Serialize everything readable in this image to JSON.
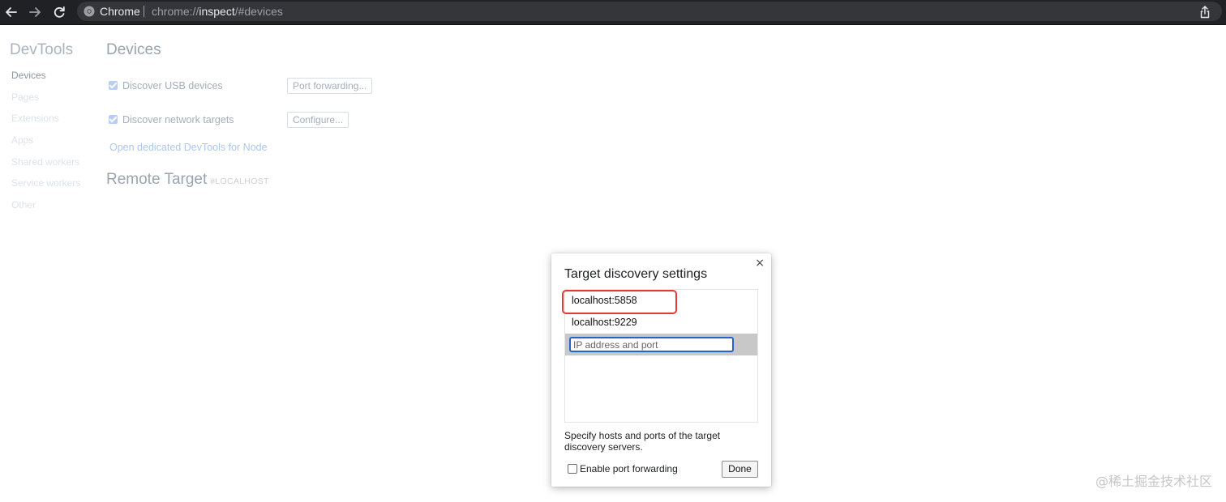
{
  "browser": {
    "tab_title": "Chrome",
    "url_scheme": "chrome://",
    "url_host": "inspect",
    "url_path": "/#devices",
    "icons": {
      "back": "back-arrow-icon",
      "forward": "forward-arrow-icon",
      "reload": "reload-icon",
      "share": "share-icon"
    }
  },
  "devtools": {
    "brand": "DevTools",
    "sidebar": [
      "Devices",
      "Pages",
      "Extensions",
      "Apps",
      "Shared workers",
      "Service workers",
      "Other"
    ],
    "section_title": "Devices",
    "discover_usb": {
      "label": "Discover USB devices",
      "checked": true
    },
    "port_forwarding_button": "Port forwarding...",
    "discover_network": {
      "label": "Discover network targets",
      "checked": true
    },
    "configure_button": "Configure...",
    "node_link": "Open dedicated DevTools for Node",
    "remote_target": {
      "title": "Remote Target",
      "subtitle": "#LOCALHOST"
    }
  },
  "dialog": {
    "title": "Target discovery settings",
    "close": "×",
    "targets": [
      "localhost:5858",
      "localhost:9229"
    ],
    "input_placeholder": "IP address and port",
    "input_value": "",
    "help_text": "Specify hosts and ports of the target discovery servers.",
    "enable_port_forwarding": {
      "label": "Enable port forwarding",
      "checked": false
    },
    "done_button": "Done",
    "highlight_color": "#e53935"
  },
  "watermark": "@稀土掘金技术社区"
}
